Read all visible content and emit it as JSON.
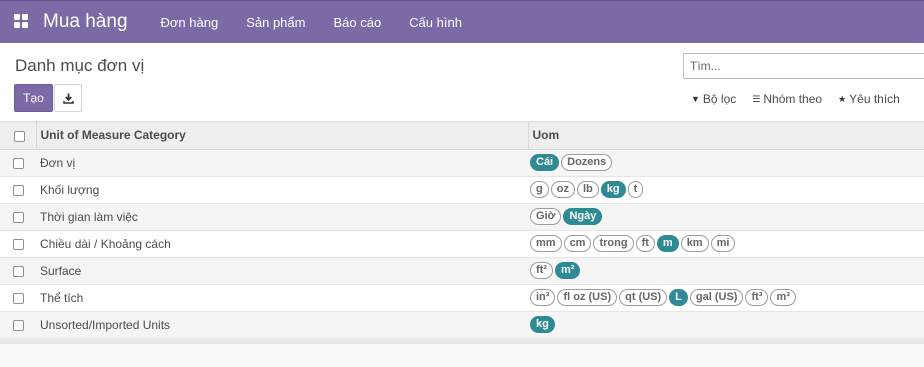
{
  "app": {
    "title": "Mua hàng",
    "menu": [
      {
        "label": "Đơn hàng"
      },
      {
        "label": "Sản phẩm"
      },
      {
        "label": "Báo cáo"
      },
      {
        "label": "Cấu hình"
      }
    ]
  },
  "control_panel": {
    "page_title": "Danh mục đơn vị",
    "create_label": "Tạo",
    "search_placeholder": "Tìm...",
    "filters_label": "Bộ lọc",
    "group_by_label": "Nhóm theo",
    "favorites_label": "Yêu thích"
  },
  "table": {
    "columns": {
      "name": "Unit of Measure Category",
      "uom": "Uom"
    },
    "rows": [
      {
        "name": "Đơn vị",
        "uoms": [
          {
            "label": "Cái",
            "reference": true
          },
          {
            "label": "Dozens",
            "reference": false
          }
        ]
      },
      {
        "name": "Khối lượng",
        "uoms": [
          {
            "label": "g",
            "reference": false
          },
          {
            "label": "oz",
            "reference": false
          },
          {
            "label": "lb",
            "reference": false
          },
          {
            "label": "kg",
            "reference": true
          },
          {
            "label": "t",
            "reference": false
          }
        ]
      },
      {
        "name": "Thời gian làm việc",
        "uoms": [
          {
            "label": "Giờ",
            "reference": false
          },
          {
            "label": "Ngày",
            "reference": true
          }
        ]
      },
      {
        "name": "Chiều dài / Khoảng cách",
        "uoms": [
          {
            "label": "mm",
            "reference": false
          },
          {
            "label": "cm",
            "reference": false
          },
          {
            "label": "trong",
            "reference": false
          },
          {
            "label": "ft",
            "reference": false
          },
          {
            "label": "m",
            "reference": true
          },
          {
            "label": "km",
            "reference": false
          },
          {
            "label": "mi",
            "reference": false
          }
        ]
      },
      {
        "name": "Surface",
        "uoms": [
          {
            "label": "ft²",
            "reference": false
          },
          {
            "label": "m²",
            "reference": true
          }
        ]
      },
      {
        "name": "Thể tích",
        "uoms": [
          {
            "label": "in³",
            "reference": false
          },
          {
            "label": "fl oz (US)",
            "reference": false
          },
          {
            "label": "qt (US)",
            "reference": false
          },
          {
            "label": "L",
            "reference": true
          },
          {
            "label": "gal (US)",
            "reference": false
          },
          {
            "label": "ft³",
            "reference": false
          },
          {
            "label": "m³",
            "reference": false
          }
        ]
      },
      {
        "name": "Unsorted/Imported Units",
        "uoms": [
          {
            "label": "kg",
            "reference": true
          }
        ]
      }
    ]
  },
  "colors": {
    "brand": "#7c6aa6",
    "reference_tag": "#2e8a94"
  }
}
